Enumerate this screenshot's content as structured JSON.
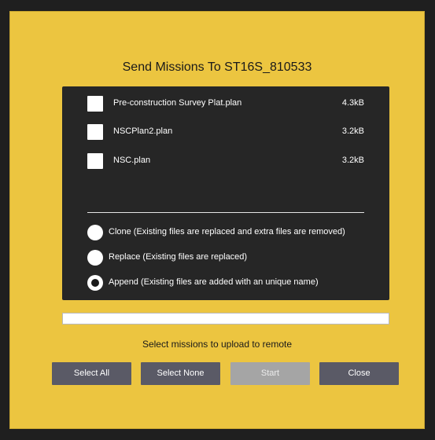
{
  "dialog": {
    "title": "Send Missions To ST16S_810533",
    "files": [
      {
        "name": "Pre-construction Survey Plat.plan",
        "size": "4.3kB",
        "checked": false
      },
      {
        "name": "NSCPlan2.plan",
        "size": "3.2kB",
        "checked": false
      },
      {
        "name": "NSC.plan",
        "size": "3.2kB",
        "checked": false
      }
    ],
    "modes": [
      {
        "label": "Clone (Existing files are replaced and extra files are removed)",
        "selected": false
      },
      {
        "label": "Replace (Existing files are replaced)",
        "selected": false
      },
      {
        "label": "Append (Existing files are added with an unique name)",
        "selected": true
      }
    ],
    "progress": 0,
    "status": "Select missions to upload to remote",
    "buttons": {
      "select_all": "Select All",
      "select_none": "Select None",
      "start": "Start",
      "close": "Close"
    }
  },
  "colors": {
    "dialog_bg": "#ecc540",
    "panel_bg": "#262626",
    "button_bg": "#5a5a66",
    "button_disabled_bg": "#a5a5a5"
  }
}
